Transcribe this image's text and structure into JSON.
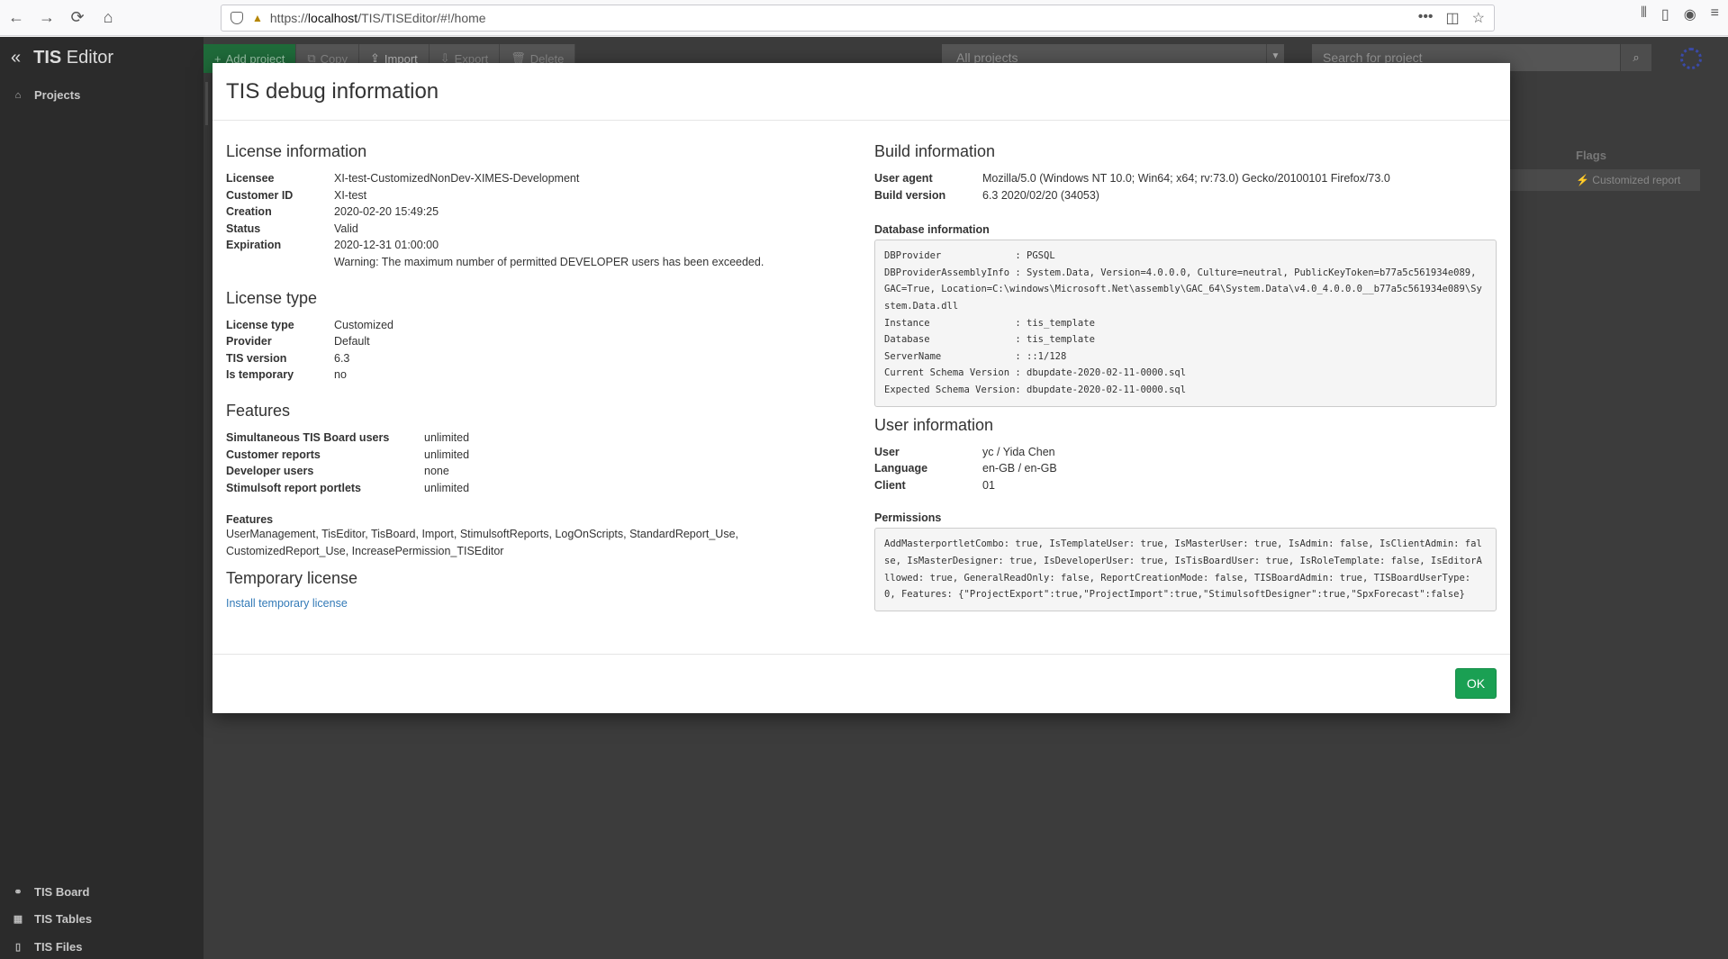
{
  "browser": {
    "url_prefix": "https://",
    "url_host": "localhost",
    "url_path": "/TIS/TISEditor/#!/home"
  },
  "app": {
    "brand_strong": "TIS",
    "brand_rest": " Editor",
    "sidebar": {
      "projects": "Projects",
      "bottom": [
        "TIS Board",
        "TIS Tables",
        "TIS Files"
      ]
    },
    "toolbar": {
      "add": "Add project",
      "copy": "Copy",
      "import": "Import",
      "export": "Export",
      "delete": "Delete"
    },
    "project_filter": "All projects",
    "search_placeholder": "Search for project",
    "flags_header": "Flags",
    "flags_value": "Customized report"
  },
  "modal": {
    "title": "TIS debug information",
    "license_info": {
      "title": "License information",
      "rows": [
        {
          "k": "Licensee",
          "v": "XI-test-CustomizedNonDev-XIMES-Development"
        },
        {
          "k": "Customer ID",
          "v": "XI-test"
        },
        {
          "k": "Creation",
          "v": "2020-02-20 15:49:25"
        },
        {
          "k": "Status",
          "v": "Valid"
        },
        {
          "k": "Expiration",
          "v": "2020-12-31 01:00:00"
        }
      ],
      "warning": "Warning: The maximum number of permitted DEVELOPER users has been exceeded."
    },
    "license_type": {
      "title": "License type",
      "rows": [
        {
          "k": "License type",
          "v": "Customized"
        },
        {
          "k": "Provider",
          "v": "Default"
        },
        {
          "k": "TIS version",
          "v": "6.3"
        },
        {
          "k": "Is temporary",
          "v": "no"
        }
      ]
    },
    "features": {
      "title": "Features",
      "rows": [
        {
          "k": "Simultaneous TIS Board users",
          "v": "unlimited"
        },
        {
          "k": "Customer reports",
          "v": "unlimited"
        },
        {
          "k": "Developer users",
          "v": "none"
        },
        {
          "k": "Stimulsoft report portlets",
          "v": "unlimited"
        }
      ],
      "list_label": "Features",
      "list": "UserManagement, TisEditor, TisBoard, Import, StimulsoftReports, LogOnScripts, StandardReport_Use, CustomizedReport_Use, IncreasePermission_TISEditor"
    },
    "temp_license": {
      "title": "Temporary license",
      "link": "Install temporary license"
    },
    "build_info": {
      "title": "Build information",
      "rows": [
        {
          "k": "User agent",
          "v": "Mozilla/5.0 (Windows NT 10.0; Win64; x64; rv:73.0) Gecko/20100101 Firefox/73.0"
        },
        {
          "k": "Build version",
          "v": "6.3 2020/02/20 (34053)"
        }
      ]
    },
    "db_info": {
      "title": "Database information",
      "text": "DBProvider             : PGSQL\nDBProviderAssemblyInfo : System.Data, Version=4.0.0.0, Culture=neutral, PublicKeyToken=b77a5c561934e089, GAC=True, Location=C:\\windows\\Microsoft.Net\\assembly\\GAC_64\\System.Data\\v4.0_4.0.0.0__b77a5c561934e089\\System.Data.dll\nInstance               : tis_template\nDatabase               : tis_template\nServerName             : ::1/128\nCurrent Schema Version : dbupdate-2020-02-11-0000.sql\nExpected Schema Version: dbupdate-2020-02-11-0000.sql"
    },
    "user_info": {
      "title": "User information",
      "rows": [
        {
          "k": "User",
          "v": "yc / Yida Chen"
        },
        {
          "k": "Language",
          "v": "en-GB / en-GB"
        },
        {
          "k": "Client",
          "v": "01"
        }
      ]
    },
    "permissions": {
      "title": "Permissions",
      "text": "AddMasterportletCombo: true, IsTemplateUser: true, IsMasterUser: true, IsAdmin: false, IsClientAdmin: false, IsMasterDesigner: true, IsDeveloperUser: true, IsTisBoardUser: true, IsRoleTemplate: false, IsEditorAllowed: true, GeneralReadOnly: false, ReportCreationMode: false, TISBoardAdmin: true, TISBoardUserType: 0, Features: {\"ProjectExport\":true,\"ProjectImport\":true,\"StimulsoftDesigner\":true,\"SpxForecast\":false}"
    },
    "ok_label": "OK"
  }
}
